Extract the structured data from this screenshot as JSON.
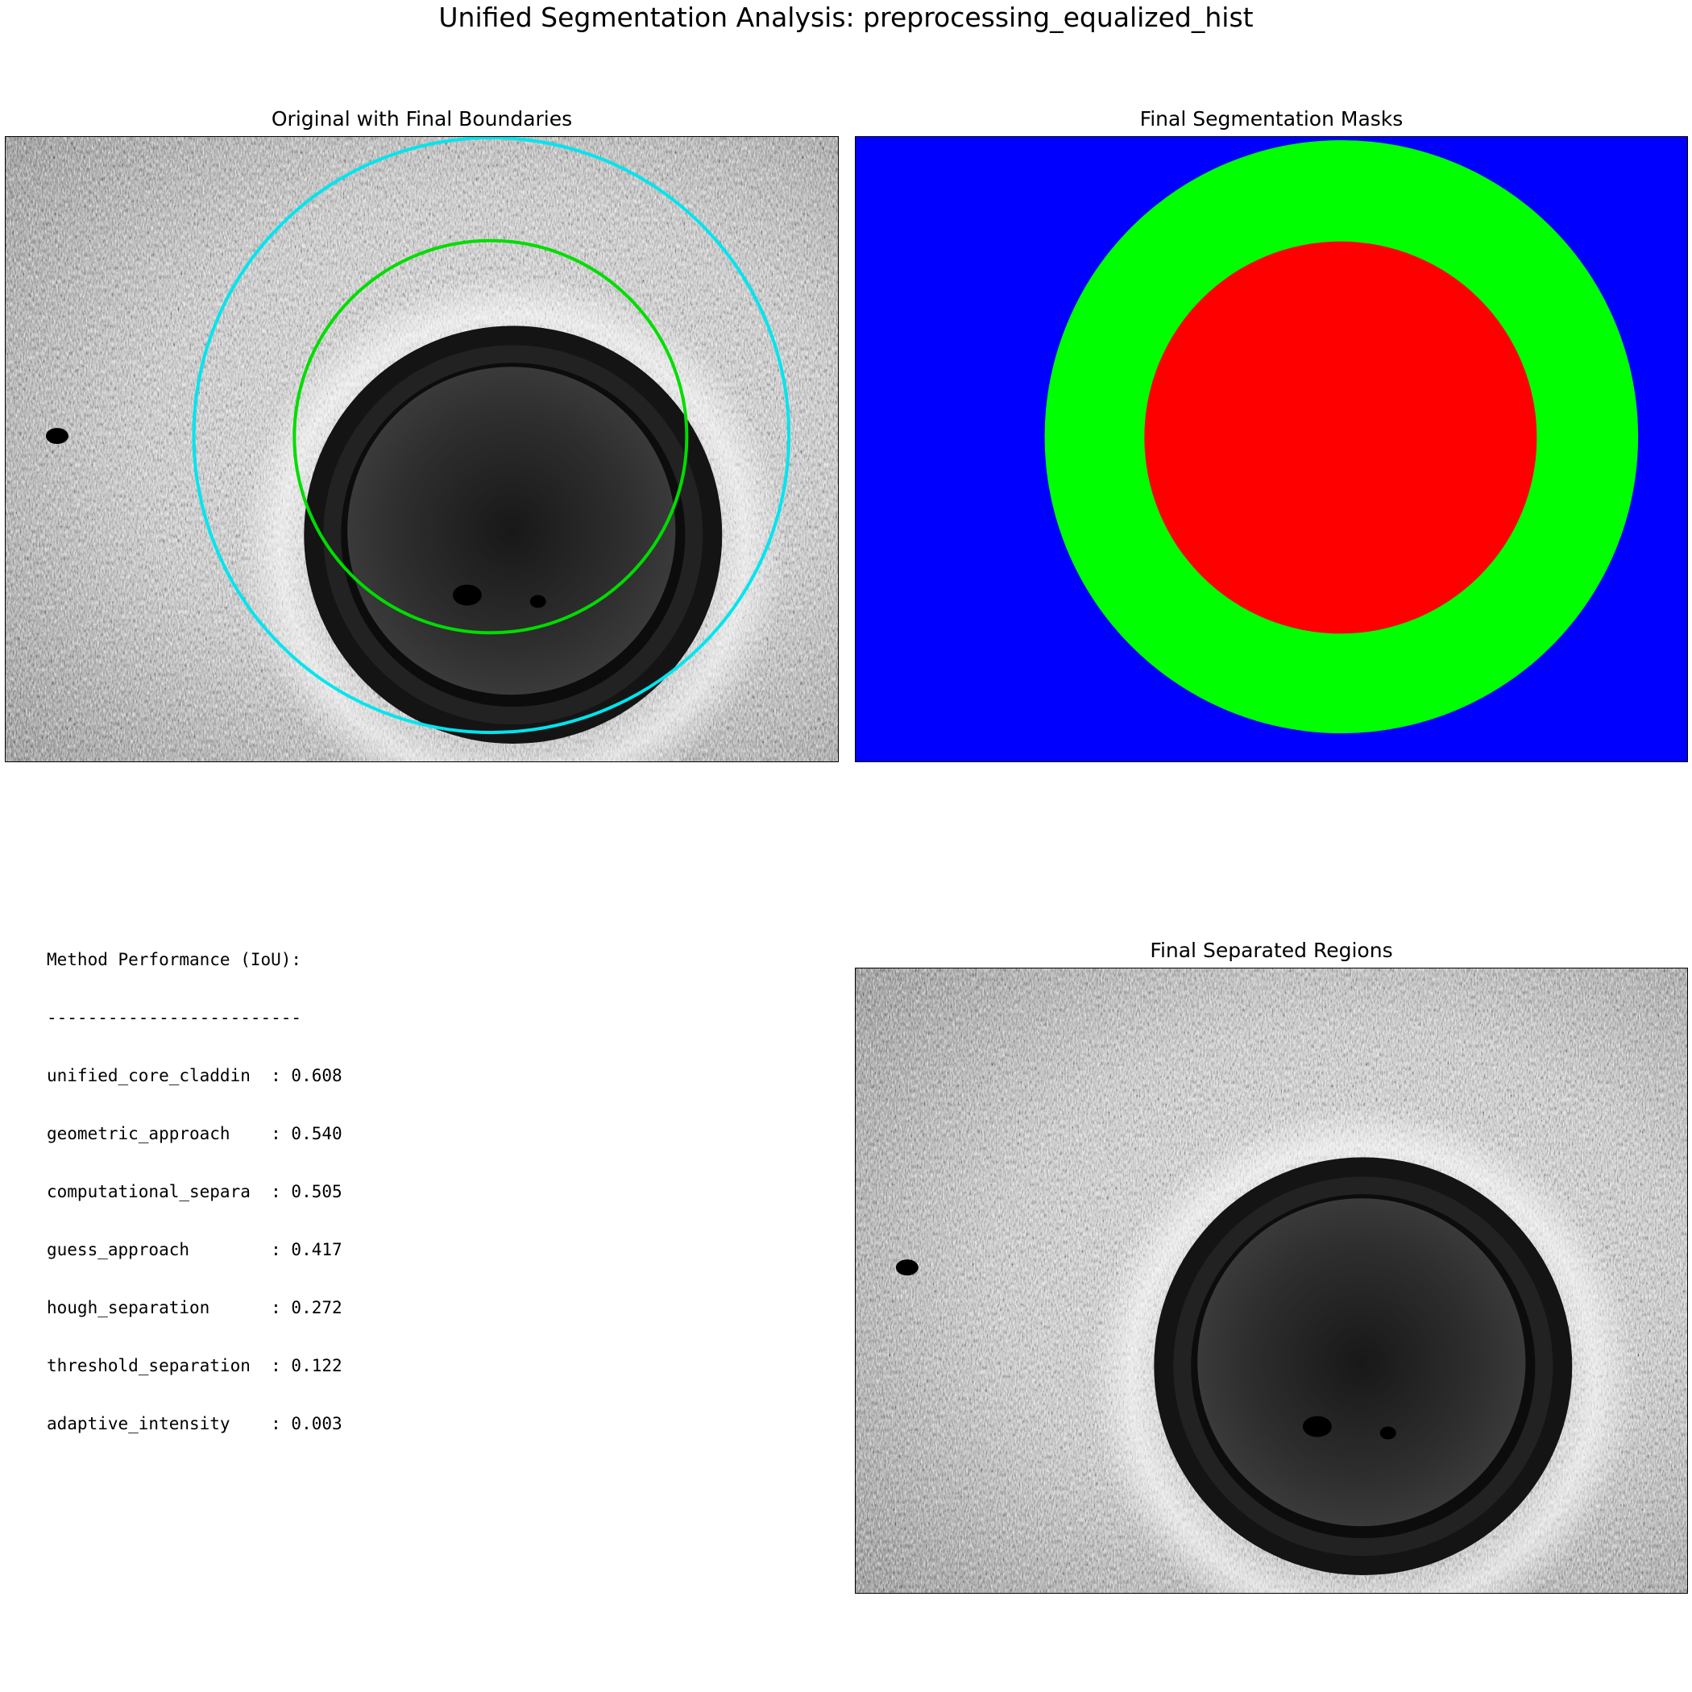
{
  "figure": {
    "title": "Unified Segmentation Analysis: preprocessing_equalized_hist"
  },
  "panels": {
    "original": {
      "title": "Original with Final Boundaries",
      "cladding_boundary_color": "#00e5ee",
      "core_boundary_color": "#00dd00"
    },
    "masks": {
      "title": "Final Segmentation Masks",
      "ferrule_color": "#0000ff",
      "cladding_color": "#00ff00",
      "core_color": "#ff0000"
    },
    "separated": {
      "title": "Final Separated Regions"
    }
  },
  "performance": {
    "heading": "Method Performance (IoU):",
    "divider": "-------------------------",
    "rows": [
      "unified_core_claddin  : 0.608",
      "geometric_approach    : 0.540",
      "computational_separa  : 0.505",
      "guess_approach        : 0.417",
      "hough_separation      : 0.272",
      "threshold_separation  : 0.122",
      "adaptive_intensity    : 0.003"
    ]
  }
}
